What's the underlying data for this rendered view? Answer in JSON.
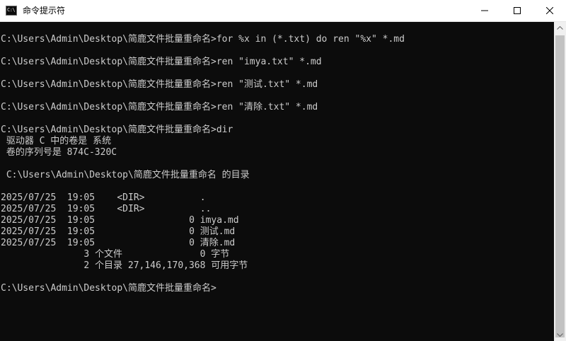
{
  "window": {
    "title": "命令提示符",
    "icon": "cmd-icon",
    "icon_label": "C:\\",
    "buttons": {
      "minimize": "minimize-icon",
      "maximize": "maximize-icon",
      "close": "close-icon"
    }
  },
  "console": {
    "lines": [
      "C:\\Users\\Admin\\Desktop\\简鹿文件批量重命名>for %x in (*.txt) do ren \"%x\" *.md",
      "",
      "C:\\Users\\Admin\\Desktop\\简鹿文件批量重命名>ren \"imya.txt\" *.md",
      "",
      "C:\\Users\\Admin\\Desktop\\简鹿文件批量重命名>ren \"测试.txt\" *.md",
      "",
      "C:\\Users\\Admin\\Desktop\\简鹿文件批量重命名>ren \"清除.txt\" *.md",
      "",
      "C:\\Users\\Admin\\Desktop\\简鹿文件批量重命名>dir",
      " 驱动器 C 中的卷是 系统",
      " 卷的序列号是 874C-320C",
      "",
      " C:\\Users\\Admin\\Desktop\\简鹿文件批量重命名 的目录",
      "",
      "2025/07/25  19:05    <DIR>          .",
      "2025/07/25  19:05    <DIR>          ..",
      "2025/07/25  19:05                 0 imya.md",
      "2025/07/25  19:05                 0 测试.md",
      "2025/07/25  19:05                 0 清除.md",
      "               3 个文件              0 字节",
      "               2 个目录 27,146,170,368 可用字节",
      "",
      "C:\\Users\\Admin\\Desktop\\简鹿文件批量重命名>"
    ]
  },
  "colors": {
    "console_background": "#0c0c0c",
    "console_text": "#cccccc",
    "titlebar_background": "#ffffff"
  }
}
